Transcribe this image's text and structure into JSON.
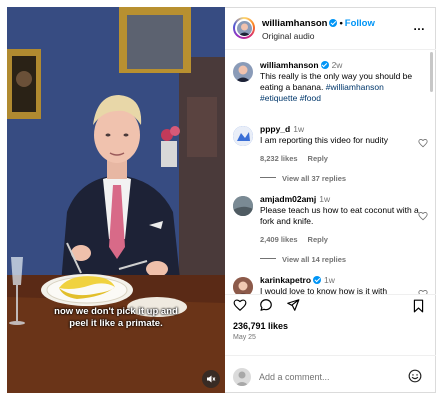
{
  "video": {
    "caption_line1": "now we don't pick it up and",
    "caption_line2": "peel it like a primate."
  },
  "header": {
    "username": "williamhanson",
    "follow_label": "Follow",
    "audio_label": "Original audio",
    "more_label": "…"
  },
  "post": {
    "username": "williamhanson",
    "time": "2w",
    "text": "This really is the only way you should be eating a banana.",
    "tags": "#williamhanson #etiquette #food"
  },
  "comments": [
    {
      "username": "pppy_d",
      "time": "1w",
      "text": "I am reporting this video for nudity",
      "likes": "8,232 likes",
      "reply": "Reply",
      "view_replies": "View all 37 replies"
    },
    {
      "username": "amjadm02amj",
      "time": "1w",
      "text": "Please teach us how to eat coconut with a fork and knife.",
      "likes": "2,409 likes",
      "reply": "Reply",
      "view_replies": "View all 14 replies"
    },
    {
      "username": "karinkapetro",
      "time": "1w",
      "text": "I would love to know how is it with"
    }
  ],
  "stats": {
    "likes": "236,791 likes",
    "date": "May 25"
  },
  "add_comment": {
    "placeholder": "Add a comment..."
  },
  "colors": {
    "accent": "#0095f6",
    "wall": "#3a4f86",
    "tag_link": "#00376b"
  }
}
